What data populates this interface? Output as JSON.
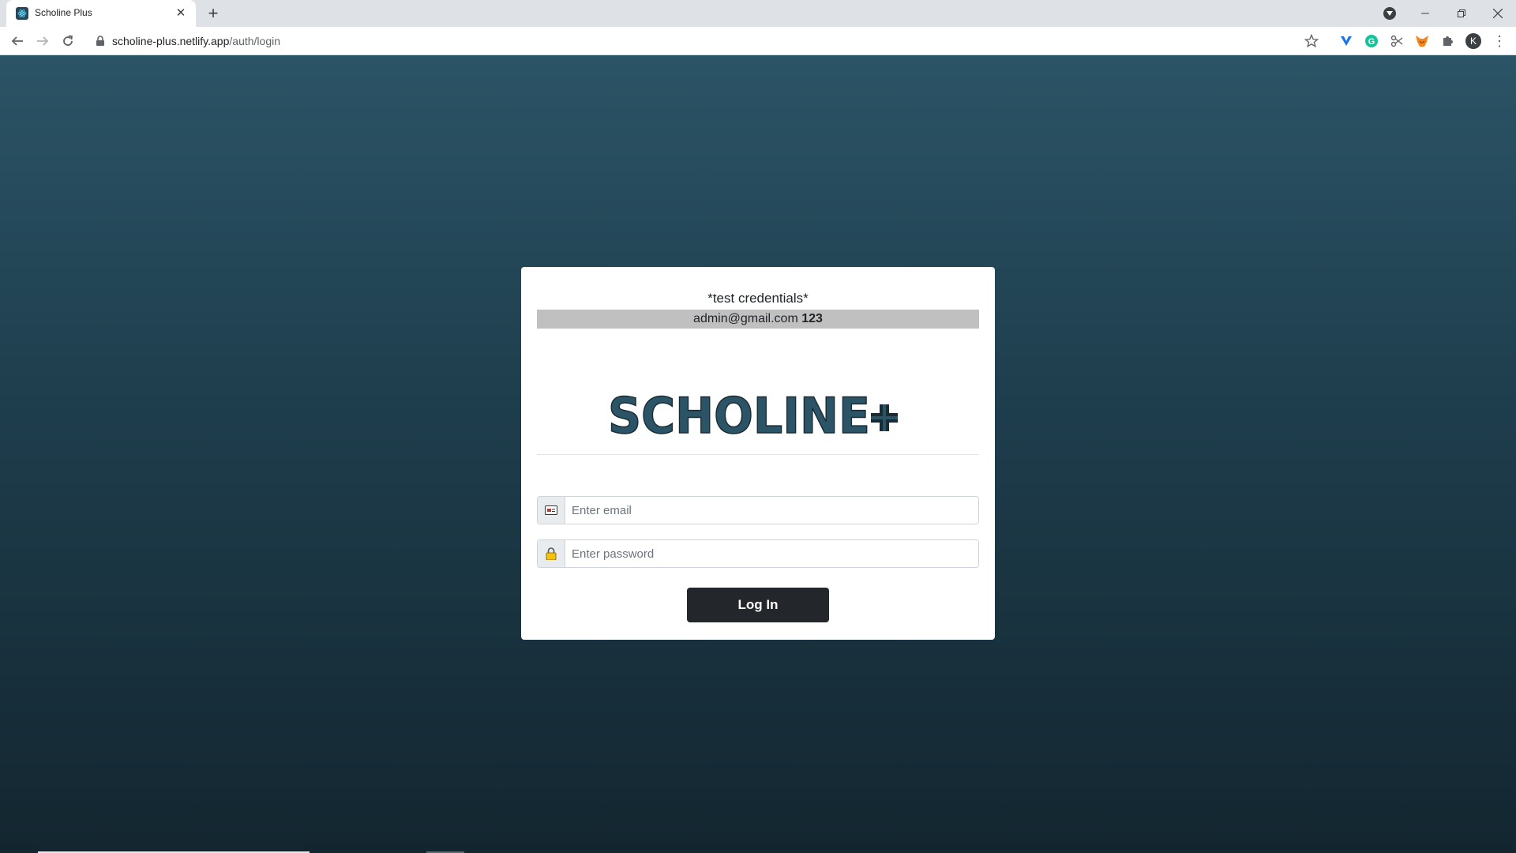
{
  "browser": {
    "tab_title": "Scholine Plus",
    "url_host": "scholine-plus.netlify.app",
    "url_path": "/auth/login",
    "profile_initial": "K"
  },
  "credentials": {
    "title": "*test credentials*",
    "email": "admin@gmail.com",
    "password": "123"
  },
  "logo": {
    "text": "SCHOLINE",
    "colors": {
      "primary": "#2b5466",
      "dark": "#1b2b33"
    }
  },
  "form": {
    "email_placeholder": "Enter email",
    "password_placeholder": "Enter password",
    "login_label": "Log In"
  }
}
